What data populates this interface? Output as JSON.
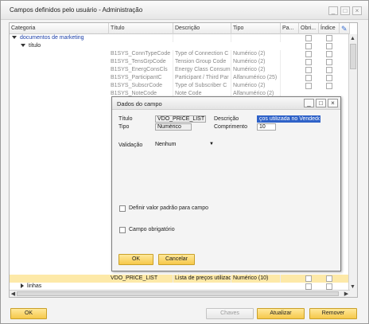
{
  "window": {
    "title": "Campos definidos pelo usuário - Administração",
    "controls": [
      "_",
      "□",
      "×"
    ]
  },
  "grid": {
    "columns": [
      "Categoria",
      "Título",
      "Descrição",
      "Tipo",
      "Pa...",
      "Obri...",
      "Índice"
    ],
    "group_label": "documentos de marketing",
    "subgroup_label": "título",
    "rows": [
      {
        "titulo": "B1SYS_ConnTypeCode",
        "descricao": "Type of Connection C",
        "tipo": "Numérico (2)"
      },
      {
        "titulo": "B1SYS_TensGrpCode",
        "descricao": "Tension Group Code",
        "tipo": "Numérico (2)"
      },
      {
        "titulo": "B1SYS_EnergConsCls",
        "descricao": "Energy Class Consum",
        "tipo": "Numérico (2)"
      },
      {
        "titulo": "B1SYS_ParticipantC",
        "descricao": "Participant / Third Par",
        "tipo": "Alfanumérico (25)"
      },
      {
        "titulo": "B1SYS_SubscrCode",
        "descricao": "Type of Subscriber C",
        "tipo": "Numérico (2)"
      },
      {
        "titulo": "B1SYS_NoteCode",
        "descricao": "Note Code",
        "tipo": "Alfanumérico (2)"
      }
    ],
    "highlight_row": {
      "titulo": "VDO_PRICE_LIST",
      "descricao": "Lista de preços utilizad",
      "tipo": "Numérico (10)"
    },
    "linhas_label": "linhas",
    "header_icon": "edit-icon"
  },
  "dialog": {
    "title": "Dados do campo",
    "controls": [
      "_",
      "□",
      "×"
    ],
    "titulo_label": "Título",
    "titulo_value": "VDO_PRICE_LIST",
    "descricao_label": "Descrição",
    "descricao_value": "ços utilizada no Vendedor",
    "tipo_label": "Tipo",
    "tipo_value": "Numérico",
    "comprimento_label": "Comprimento",
    "comprimento_value": "10",
    "validacao_label": "Validação",
    "validacao_value": "Nenhum",
    "default_checkbox_label": "Definir valor padrão para campo",
    "required_checkbox_label": "Campo obrigatório",
    "ok_label": "OK",
    "cancel_label": "Cancelar"
  },
  "footer": {
    "ok_label": "OK",
    "chaves_label": "Chaves",
    "atualizar_label": "Atualizar",
    "remover_label": "Remover"
  }
}
